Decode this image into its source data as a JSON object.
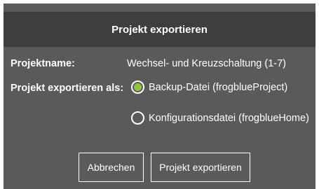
{
  "dialog": {
    "title": "Projekt exportieren",
    "project_name_label": "Projektname:",
    "project_name_value": "Wechsel- und Kreuzschaltung (1-7)",
    "export_as_label": "Projekt exportieren als:",
    "options": [
      {
        "label": "Backup-Datei (frogblueProject)",
        "checked": true
      },
      {
        "label": "Konfigurationsdatei (frogblueHome)",
        "checked": false
      }
    ],
    "cancel_label": "Abbrechen",
    "export_label": "Projekt exportieren"
  },
  "colors": {
    "dialog_bg": "#5a5a5a",
    "titlebar_bg": "#3e3e3e",
    "radio_selected": "#8ec641",
    "text": "#ffffff"
  }
}
